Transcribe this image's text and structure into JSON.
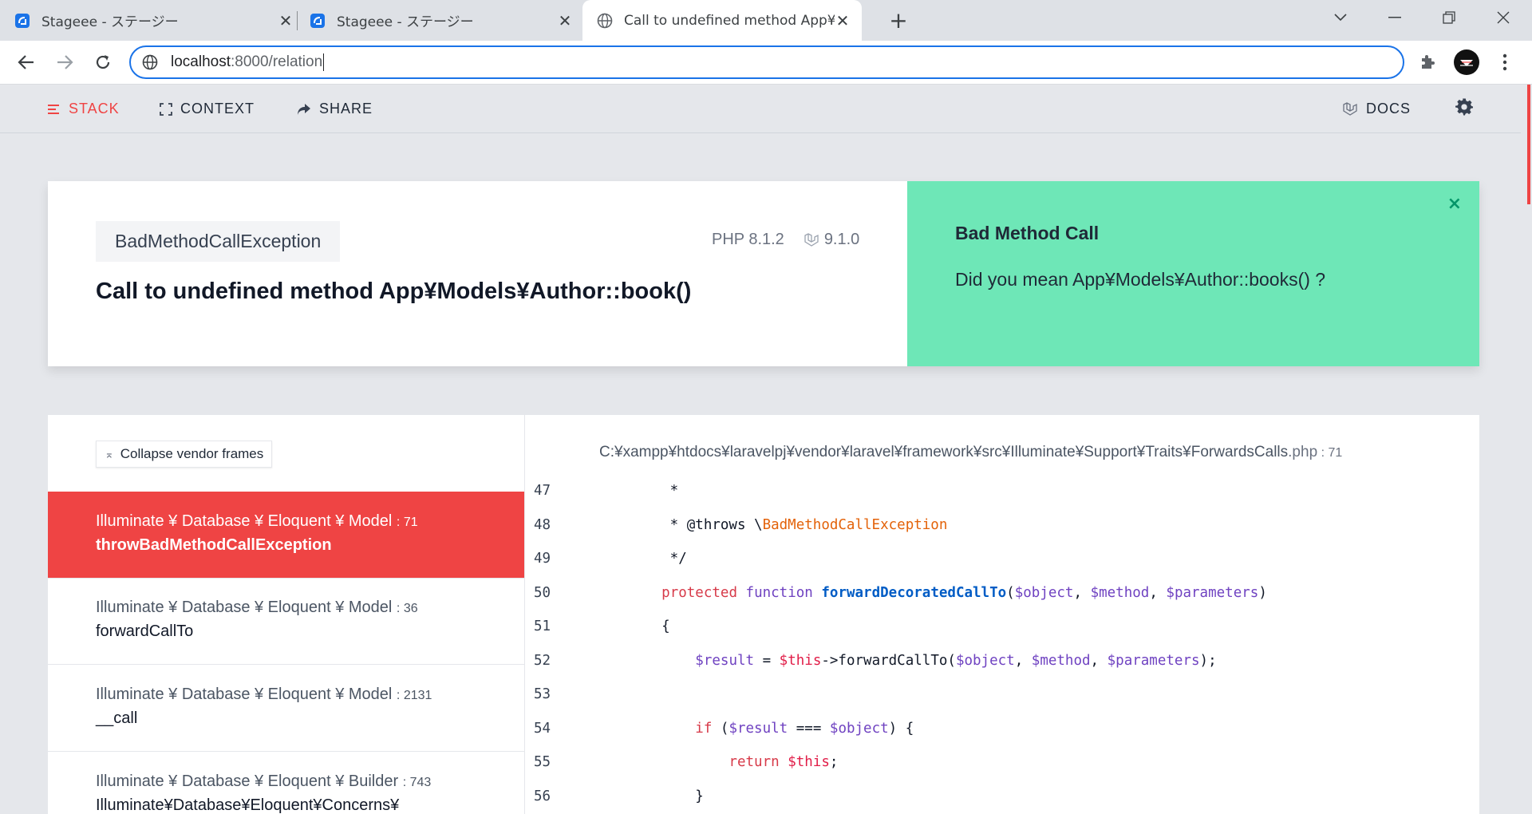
{
  "browser": {
    "tabs": [
      {
        "title": "Stageee - ステージー",
        "active": false
      },
      {
        "title": "Stageee - ステージー",
        "active": false
      },
      {
        "title": "Call to undefined method App¥M",
        "active": true
      }
    ],
    "new_tab": "+",
    "close_glyph": "✕",
    "address": {
      "host": "localhost",
      "path": ":8000/relation"
    }
  },
  "ignition_nav": {
    "stack": "STACK",
    "context": "CONTEXT",
    "share": "SHARE",
    "docs": "DOCS"
  },
  "exception": {
    "class": "BadMethodCallException",
    "php_version": "PHP 8.1.2",
    "laravel_version": "9.1.0",
    "message": "Call to undefined method App¥Models¥Author::book()"
  },
  "solution": {
    "title": "Bad Method Call",
    "body": "Did you mean App¥Models¥Author::books() ?",
    "close": "×"
  },
  "stack": {
    "collapse_label": "Collapse vendor frames",
    "frames": [
      {
        "class": "Illuminate ¥ Database ¥ Eloquent ¥ Model",
        "line": ": 71",
        "method": "throwBadMethodCallException",
        "active": true
      },
      {
        "class": "Illuminate ¥ Database ¥ Eloquent ¥ Model",
        "line": ": 36",
        "method": "forwardCallTo",
        "active": false
      },
      {
        "class": "Illuminate ¥ Database ¥ Eloquent ¥ Model",
        "line": ": 2131",
        "method": "__call",
        "active": false
      },
      {
        "class": "Illuminate ¥ Database ¥ Eloquent ¥ Builder",
        "line": ": 743",
        "method": "Illuminate¥Database¥Eloquent¥Concerns¥",
        "active": false
      }
    ],
    "file": {
      "path": "C:¥xampp¥htdocs¥laravelpj¥vendor¥laravel¥framework¥src¥Illuminate¥Support¥Traits¥ForwardsCalls",
      "ext": ".php",
      "line": " : 71"
    },
    "code_lines": [
      {
        "num": "47",
        "text": "     *"
      },
      {
        "num": "48",
        "text": "     * @throws \\BadMethodCallException"
      },
      {
        "num": "49",
        "text": "     */"
      },
      {
        "num": "50",
        "text": "    protected function forwardDecoratedCallTo($object, $method, $parameters)"
      },
      {
        "num": "51",
        "text": "    {"
      },
      {
        "num": "52",
        "text": "        $result = $this->forwardCallTo($object, $method, $parameters);"
      },
      {
        "num": "53",
        "text": ""
      },
      {
        "num": "54",
        "text": "        if ($result === $object) {"
      },
      {
        "num": "55",
        "text": "            return $this;"
      },
      {
        "num": "56",
        "text": "        }"
      }
    ]
  },
  "colors": {
    "accent_red": "#ef4444",
    "solution_green": "#6ee7b7",
    "focus_blue": "#1a73e8"
  },
  "icons": {
    "tab_favicon": "stageee-favicon-icon",
    "active_tab_favicon": "globe-icon",
    "back": "arrow-left-icon",
    "forward": "arrow-right-icon",
    "reload": "reload-icon",
    "extensions": "puzzle-icon",
    "settings": "gear-icon",
    "docs": "laravel-icon"
  }
}
